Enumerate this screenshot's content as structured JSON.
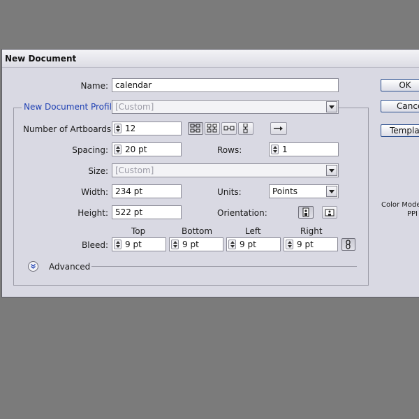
{
  "dialog": {
    "title": "New Document",
    "name_label": "Name:",
    "name_value": "calendar",
    "profile_label": "New Document Profile:",
    "profile_value": "[Custom]",
    "artboards_label": "Number of Artboards:",
    "artboards_value": "12",
    "spacing_label": "Spacing:",
    "spacing_value": "20 pt",
    "rows_label": "Rows:",
    "rows_value": "1",
    "size_label": "Size:",
    "size_value": "[Custom]",
    "width_label": "Width:",
    "width_value": "234 pt",
    "units_label": "Units:",
    "units_value": "Points",
    "height_label": "Height:",
    "height_value": "522 pt",
    "orientation_label": "Orientation:",
    "bleed_label": "Bleed:",
    "bleed": {
      "top_label": "Top",
      "bottom_label": "Bottom",
      "left_label": "Left",
      "right_label": "Right",
      "top": "9 pt",
      "bottom": "9 pt",
      "left": "9 pt",
      "right": "9 pt"
    },
    "advanced_label": "Advanced",
    "buttons": {
      "ok": "OK",
      "cancel": "Cancel",
      "templates": "Templates..."
    },
    "side_info": {
      "color_mode": "Color Mode",
      "ppi": "PPI"
    },
    "icons": {
      "grid_by_row": "grid-by-row-icon",
      "grid_by_column": "grid-by-column-icon",
      "arrange_by_row": "arrange-by-row-icon",
      "arrange_by_column": "arrange-by-column-icon",
      "layout_direction": "arrow-right-icon",
      "portrait": "portrait-icon",
      "landscape": "landscape-icon",
      "link_bleed": "link-icon",
      "advanced_toggle": "chevron-down-icon"
    },
    "accent_color": "#1d3fb3"
  }
}
